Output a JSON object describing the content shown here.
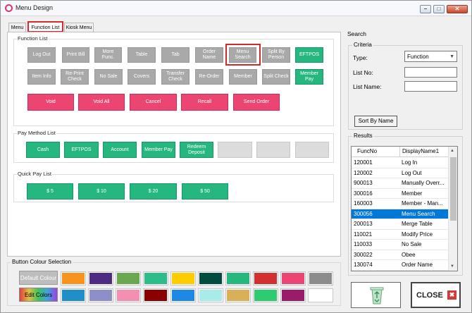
{
  "window": {
    "title": "Menu Design",
    "min_glyph": "–",
    "max_glyph": "□",
    "close_glyph": "✕"
  },
  "tabs": [
    "Menu",
    "Function List",
    "Kiosk Menu"
  ],
  "function_list": {
    "title": "Function List",
    "row1": [
      "Log Out",
      "Print Bill",
      "More Func.",
      "Table",
      "Tab",
      "Order Name",
      "Menu Search",
      "Split By Person",
      "EFTPOS"
    ],
    "row2": [
      "Item Info",
      "Re-Print Check",
      "No Sale",
      "Covers",
      "Transfer Check",
      "Re-Order",
      "Member",
      "Split Check",
      "Member Pay"
    ],
    "row3": [
      "Void",
      "Void All",
      "Cancel",
      "Recall",
      "Send Order"
    ]
  },
  "pay_method": {
    "title": "Pay Method List",
    "buttons": [
      "Cash",
      "EFTPOS",
      "Account",
      "Member Pay",
      "Redeem Deposit"
    ]
  },
  "quick_pay": {
    "title": "Quick Pay List",
    "buttons": [
      "$ 5",
      "$ 10",
      "$ 20",
      "$ 50"
    ]
  },
  "colour_selection": {
    "title": "Button Colour Selection",
    "default_label": "Default Colour",
    "edit_label": "Edit Colors",
    "row1": [
      "#f7941d",
      "#4e2a84",
      "#6aa84f",
      "#2dbd8a",
      "#ffcc00",
      "#004d40",
      "#25b77d",
      "#d32f2f",
      "#ec4572",
      "#8c8c8c"
    ],
    "row2": [
      "#1f8ec9",
      "#8e8ec8",
      "#f48fb1",
      "#8b0000",
      "#1e88e5",
      "#a8ece8",
      "#d9b05a",
      "#2ecc71",
      "#9b1b6b",
      "#ffffff"
    ]
  },
  "search": {
    "title": "Search",
    "criteria_title": "Criteria",
    "type_label": "Type:",
    "type_value": "Function",
    "list_no_label": "List No:",
    "list_name_label": "List Name:",
    "sort_button": "Sort By Name"
  },
  "results": {
    "title": "Results",
    "headers": [
      "FuncNo",
      "DisplayName1"
    ],
    "rows": [
      [
        "120001",
        "Log In"
      ],
      [
        "120002",
        "Log Out"
      ],
      [
        "900013",
        "Manually Overr..."
      ],
      [
        "300016",
        "Member"
      ],
      [
        "160003",
        "Member - Man..."
      ],
      [
        "300056",
        "Menu Search"
      ],
      [
        "200013",
        "Merge Table"
      ],
      [
        "110021",
        "Modify Price"
      ],
      [
        "110033",
        "No Sale"
      ],
      [
        "300022",
        "Obee"
      ],
      [
        "130074",
        "Order Name"
      ]
    ],
    "selected_index": 5
  },
  "close_button": {
    "label": "CLOSE"
  }
}
